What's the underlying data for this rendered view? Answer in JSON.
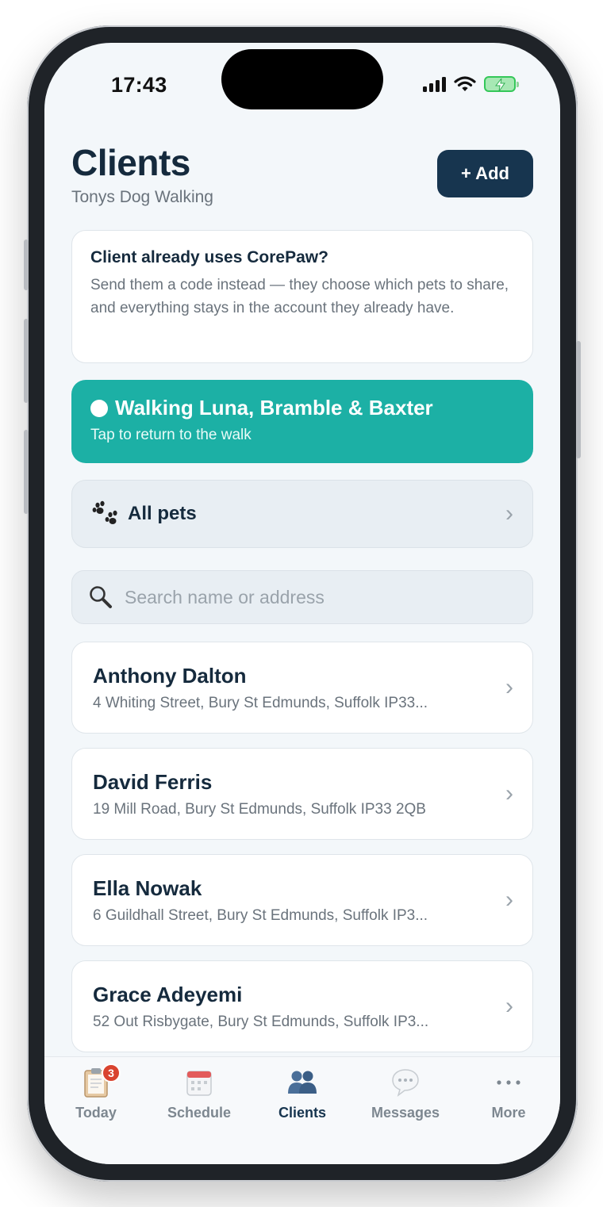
{
  "status": {
    "time": "17:43"
  },
  "header": {
    "title": "Clients",
    "subtitle": "Tonys Dog Walking",
    "add_label": "+ Add"
  },
  "info_card": {
    "title": "Client already uses CorePaw?",
    "body": "Send them a code instead — they choose which pets to share, and everything stays in the account they already have."
  },
  "walk_banner": {
    "title": "Walking Luna, Bramble & Baxter",
    "subtitle": "Tap to return to the walk"
  },
  "all_pets": {
    "label": "All pets"
  },
  "search": {
    "placeholder": "Search name or address",
    "value": ""
  },
  "clients": [
    {
      "name": "Anthony Dalton",
      "address": "4 Whiting Street, Bury St Edmunds, Suffolk IP33..."
    },
    {
      "name": "David Ferris",
      "address": "19 Mill Road, Bury St Edmunds, Suffolk IP33 2QB"
    },
    {
      "name": "Ella Nowak",
      "address": "6 Guildhall Street, Bury St Edmunds, Suffolk IP3..."
    },
    {
      "name": "Grace Adeyemi",
      "address": "52 Out Risbygate, Bury St Edmunds, Suffolk IP3..."
    }
  ],
  "tabbar": {
    "active": "Clients",
    "tabs": [
      {
        "label": "Today",
        "icon": "clipboard-icon",
        "badge": "3"
      },
      {
        "label": "Schedule",
        "icon": "calendar-icon"
      },
      {
        "label": "Clients",
        "icon": "people-icon"
      },
      {
        "label": "Messages",
        "icon": "speech-bubble-icon"
      },
      {
        "label": "More",
        "icon": "ellipsis-icon"
      }
    ]
  },
  "colors": {
    "primary_navy": "#17354f",
    "walk_teal": "#1cb0a5",
    "badge_red": "#d9432f",
    "background": "#f3f7fa"
  }
}
